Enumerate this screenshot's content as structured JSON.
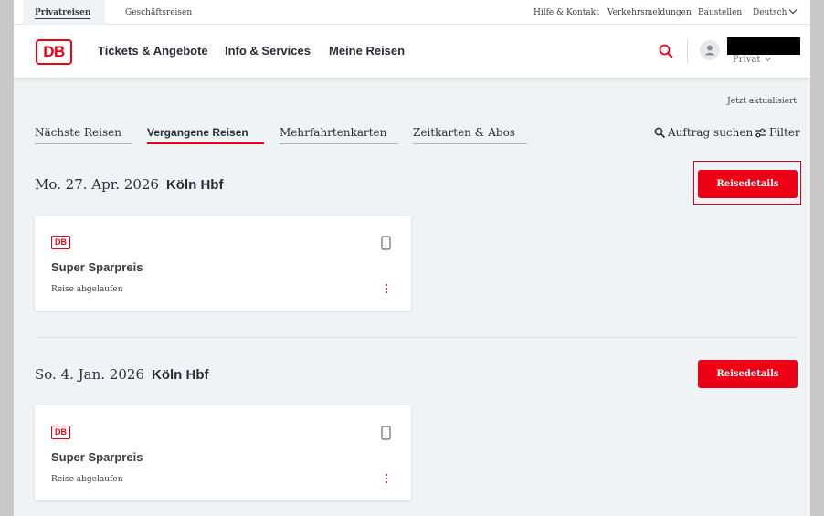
{
  "metabar": {
    "private_label": "Privatreisen",
    "business_label": "Geschäftsreisen",
    "links": [
      "Hilfe & Kontakt",
      "Verkehrsmeldungen",
      "Baustellen"
    ],
    "language": "Deutsch"
  },
  "header": {
    "logo_text": "DB",
    "nav": [
      "Tickets & Angebote",
      "Info & Services",
      "Meine Reisen"
    ],
    "account_type": "Privat"
  },
  "main": {
    "updated_text": "Jetzt aktualisiert",
    "tabs": [
      "Nächste Reisen",
      "Vergangene Reisen",
      "Mehrfahrtenkarten",
      "Zeitkarten & Abos"
    ],
    "active_tab": "Vergangene Reisen",
    "search_order_label": "Auftrag suchen",
    "filter_label": "Filter",
    "trips": [
      {
        "date": "Mo. 27. Apr. 2026",
        "station": "Köln Hbf",
        "button_label": "Reisedetails",
        "card": {
          "logo": "DB",
          "title": "Super Sparpreis",
          "status": "Reise abgelaufen"
        }
      },
      {
        "date": "So. 4. Jan. 2026",
        "station": "Köln Hbf",
        "button_label": "Reisedetails",
        "card": {
          "logo": "DB",
          "title": "Super Sparpreis",
          "status": "Reise abgelaufen"
        }
      }
    ]
  },
  "colors": {
    "brand_red": "#ec0016",
    "text": "#282d37",
    "background": "#f0f3f5"
  }
}
